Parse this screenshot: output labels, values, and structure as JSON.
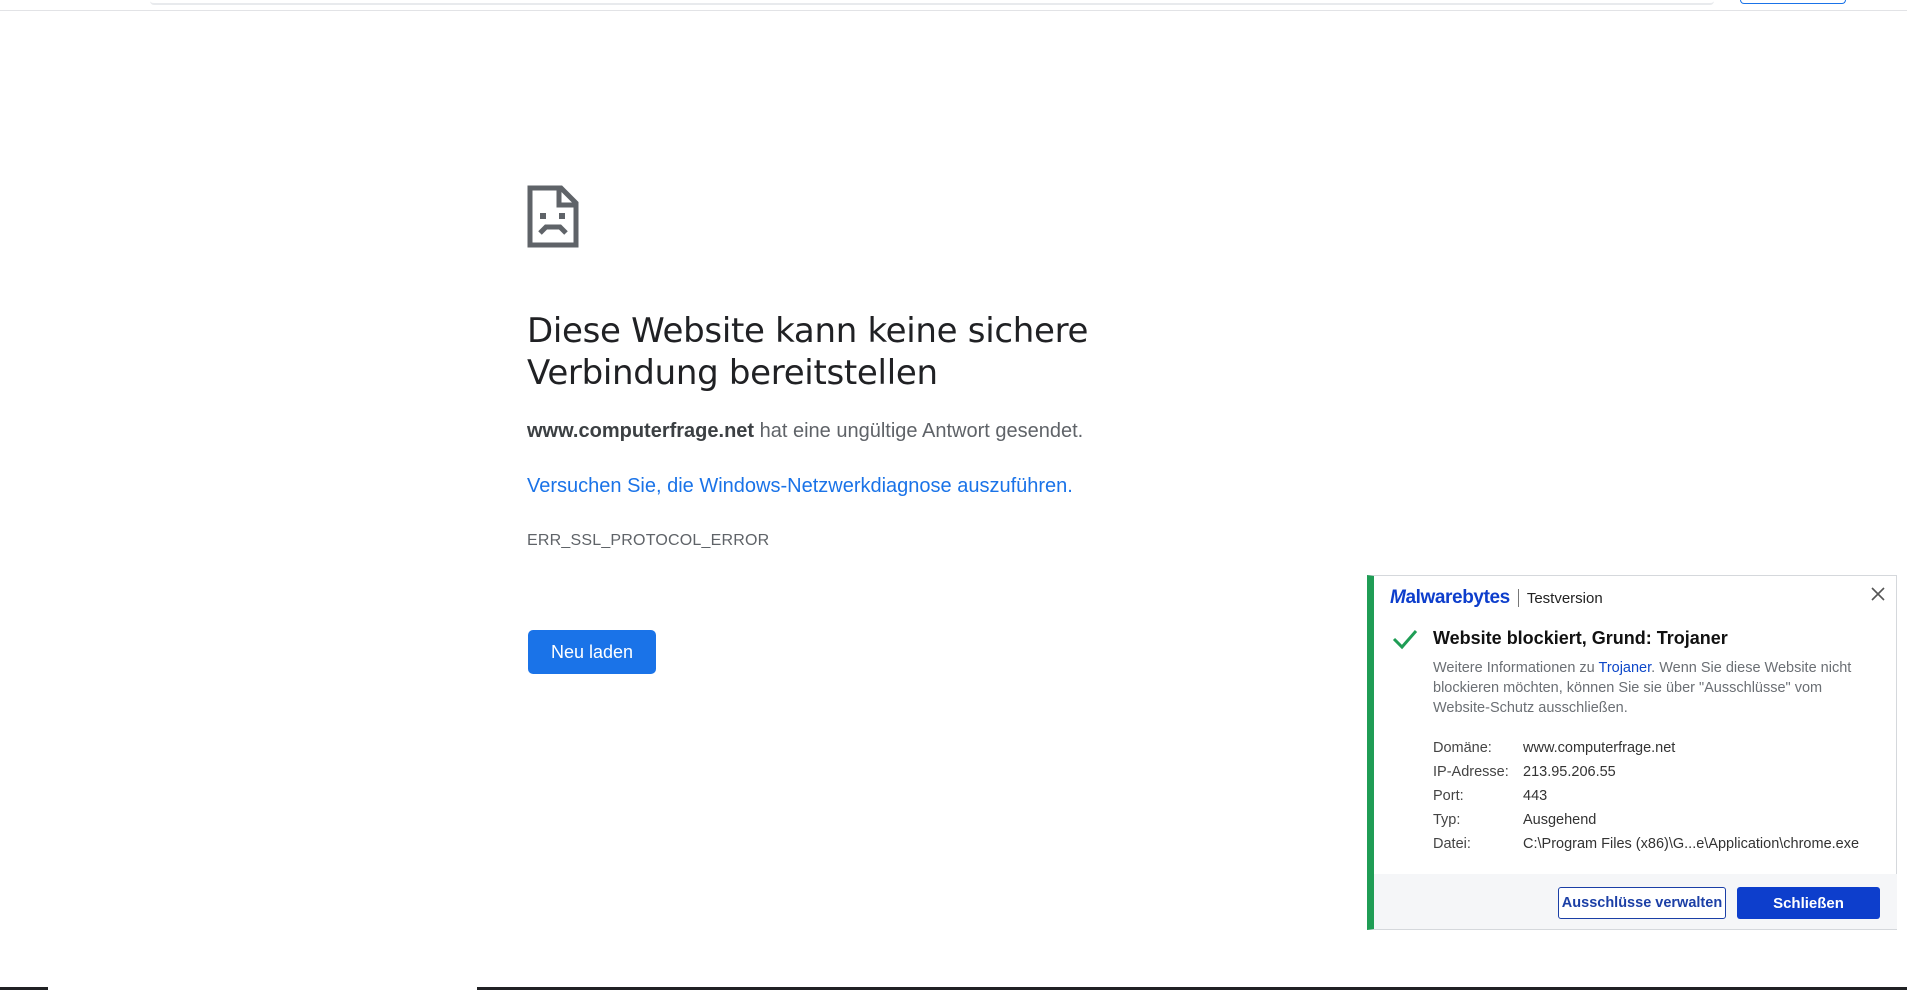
{
  "error_page": {
    "title": "Diese Website kann keine sichere Verbindung bereitstellen",
    "domain": "www.computerfrage.net",
    "description_rest": " hat eine ungültige Antwort gesendet.",
    "diagnose_link": "Versuchen Sie, die Windows-Netzwerkdiagnose auszuführen.",
    "error_code": "ERR_SSL_PROTOCOL_ERROR",
    "reload_label": "Neu laden",
    "icon": "sad-page-icon"
  },
  "malwarebytes": {
    "brand": "Malwarebytes",
    "version_label": "Testversion",
    "title": "Website blockiert, Grund: Trojaner",
    "info_prefix": "Weitere Informationen zu ",
    "info_link": "Trojaner",
    "info_suffix": ". Wenn Sie diese Website nicht blockieren möchten, können Sie sie über \"Ausschlüsse\" vom Website-Schutz ausschließen.",
    "details": [
      {
        "label": "Domäne:",
        "value": "www.computerfrage.net"
      },
      {
        "label": "IP-Adresse:",
        "value": "213.95.206.55"
      },
      {
        "label": "Port:",
        "value": "443"
      },
      {
        "label": "Typ:",
        "value": "Ausgehend"
      },
      {
        "label": "Datei:",
        "value": "C:\\Program Files (x86)\\G...e\\Application\\chrome.exe"
      }
    ],
    "exclusions_button": "Ausschlüsse verwalten",
    "close_button": "Schließen",
    "colors": {
      "accent": "#1f9d55",
      "brand": "#0d3ecc"
    }
  },
  "colors": {
    "link": "#1a73e8",
    "button": "#1a73e8"
  }
}
